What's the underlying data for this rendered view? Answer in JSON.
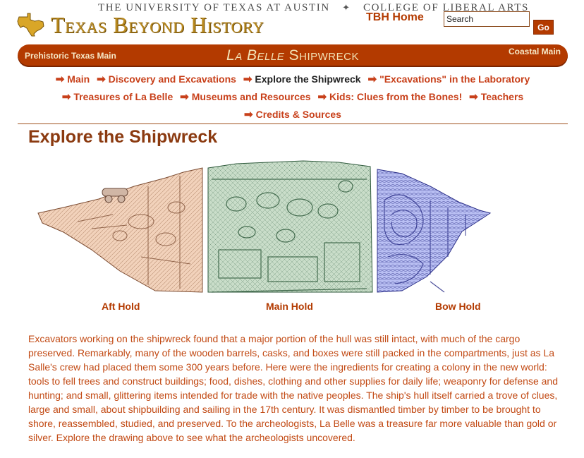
{
  "header": {
    "university_line_left": "THE UNIVERSITY OF TEXAS AT AUSTIN",
    "university_line_sep": "✦",
    "university_line_right": "COLLEGE OF LIBERAL ARTS",
    "site_title": "Texas Beyond History",
    "home_link": "TBH Home",
    "search": {
      "value": "Search",
      "go_label": "Go"
    }
  },
  "banner": {
    "left_link": "Prehistoric Texas Main",
    "title_italic": "La Belle",
    "title_rest": " Shipwreck",
    "right_link": "Coastal Main"
  },
  "nav": {
    "arrow": "➡",
    "items": [
      {
        "label": "Main"
      },
      {
        "label": "Discovery and Excavations"
      },
      {
        "label": "Explore the Shipwreck"
      },
      {
        "label": "\"Excavations\" in the Laboratory"
      },
      {
        "label": "Treasures of La Belle"
      },
      {
        "label": "Museums and Resources"
      },
      {
        "label": "Kids: Clues from the Bones!"
      },
      {
        "label": "Teachers"
      },
      {
        "label": "Credits & Sources"
      }
    ]
  },
  "main": {
    "title": "Explore the Shipwreck",
    "holds": [
      {
        "label": "Aft Hold",
        "color": "#f2d2bb"
      },
      {
        "label": "Main Hold",
        "color": "#c9ddc9"
      },
      {
        "label": "Bow Hold",
        "color": "#b9bff3"
      }
    ],
    "description": "Excavators working on the shipwreck found that a major portion of the hull was still intact, with much of the cargo preserved. Remarkably, many of the wooden barrels, casks, and boxes were still packed in the compartments, just as La Salle's crew had placed them some 300 years before. Here were the ingredients for creating a colony in the new world: tools to fell trees and construct buildings; food, dishes, clothing and other supplies for daily life; weaponry for defense and hunting; and small, glittering items intended for trade with the native peoples. The ship's hull itself carried a trove of clues, large and small, about shipbuilding and sailing in the 17th century. It was dismantled timber by timber to be brought to shore, reassembled, studied, and preserved. To the archeologists, La Belle was a treasure far more valuable than gold or silver. Explore the drawing above to see what the archeologists uncovered."
  },
  "colors": {
    "accent": "#b33a00",
    "title": "#8b3a10",
    "text": "#c24a14",
    "logo_gold": "#b98a1f"
  }
}
